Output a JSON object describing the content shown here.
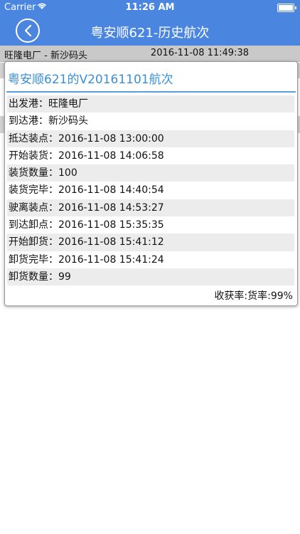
{
  "status_bar": {
    "carrier": "Carrier",
    "time": "11:26 AM"
  },
  "nav": {
    "title": "粤安顺621-历史航次"
  },
  "list": {
    "first_row": {
      "route": "旺隆电厂  -  新沙码头",
      "timestamp": "2016-11-08 11:49:38"
    }
  },
  "modal": {
    "title": "粤安顺621的V20161101航次",
    "rows": [
      "出发港：旺隆电厂",
      "到达港：新沙码头",
      "抵达装点：2016-11-08 13:00:00",
      "开始装货：2016-11-08 14:06:58",
      "装货数量：100",
      "装货完毕：2016-11-08 14:40:54",
      "驶离装点：2016-11-08 14:53:27",
      "到达卸点：2016-11-08 15:35:35",
      "开始卸货：2016-11-08 15:41:12",
      "卸货完毕：2016-11-08 15:41:24",
      "卸货数量：99"
    ],
    "ratio": "收获率:货率:99%"
  },
  "colors": {
    "accent": "#4a86e0",
    "title_blue": "#3a8fd6"
  }
}
